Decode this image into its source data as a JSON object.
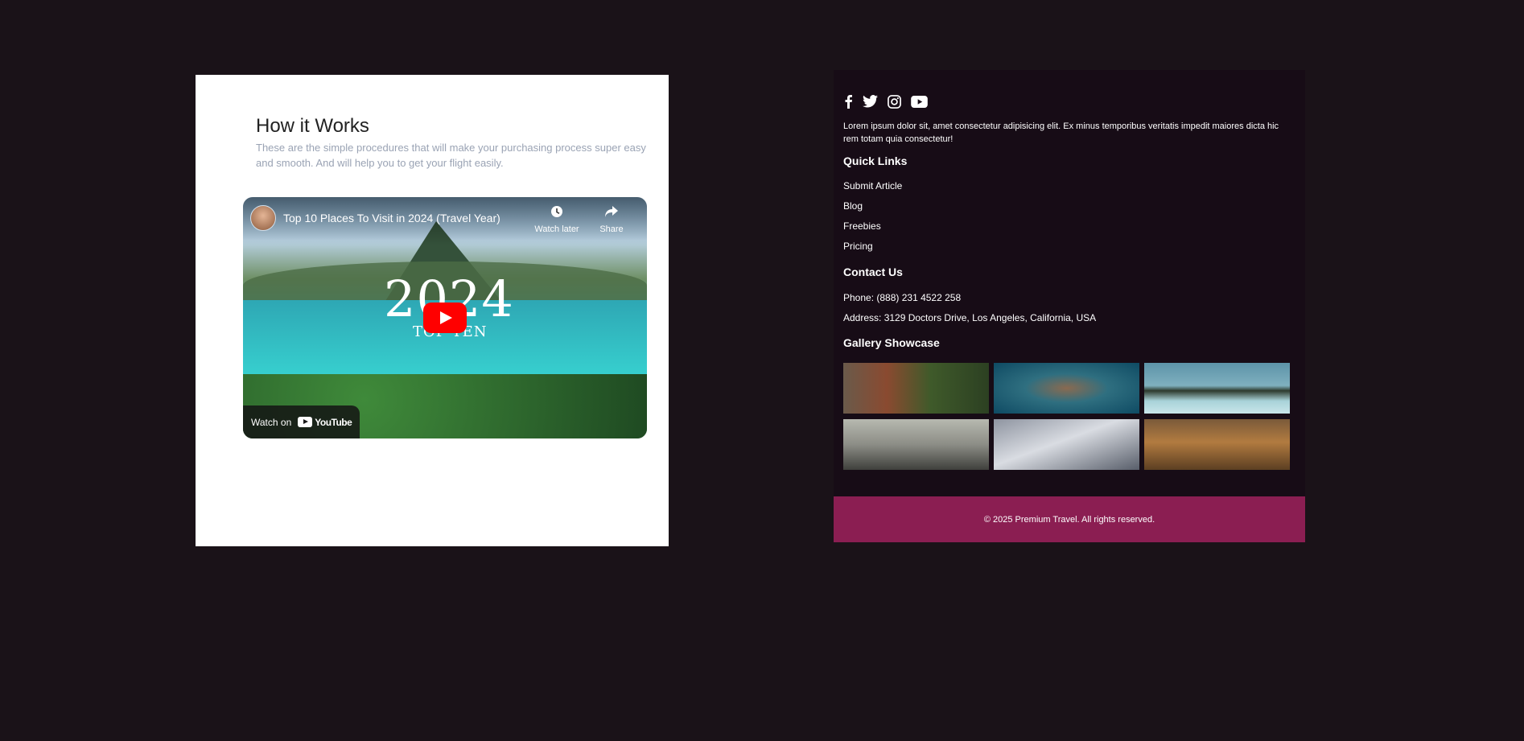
{
  "how_it_works": {
    "title": "How it Works",
    "description": "These are the simple procedures that will make your purchasing process super easy and smooth. And will help you to get your flight easily."
  },
  "video": {
    "title": "Top 10 Places To Visit in 2024 (Travel Year)",
    "watch_later_label": "Watch later",
    "share_label": "Share",
    "overlay_year": "2024",
    "overlay_subtitle": "TOP TEN",
    "watch_on_label": "Watch on",
    "youtube_logo_text": "YouTube",
    "icons": [
      "clock-icon",
      "share-arrow-icon",
      "play-icon",
      "youtube-logo"
    ]
  },
  "footer": {
    "social_icons": [
      "facebook-icon",
      "twitter-icon",
      "instagram-icon",
      "youtube-icon"
    ],
    "about_text": "Lorem ipsum dolor sit, amet consectetur adipisicing elit. Ex minus temporibus veritatis impedit maiores dicta hic rem totam quia consectetur!",
    "quick_links_title": "Quick Links",
    "quick_links": [
      "Submit Article",
      "Blog",
      "Freebies",
      "Pricing"
    ],
    "contact_title": "Contact Us",
    "phone": "Phone: (888) 231 4522 258",
    "address": "Address: 3129 Doctors Drive, Los Angeles, California, USA",
    "gallery_title": "Gallery Showcase",
    "gallery_count": 6,
    "copyright": "© 2025 Premium Travel. All rights reserved."
  },
  "colors": {
    "page_background": "#1a1218",
    "footer_background": "#170c16",
    "copyright_bar": "#8b1e52",
    "youtube_red": "#ff0000",
    "description_gray": "#9aa3b4"
  }
}
